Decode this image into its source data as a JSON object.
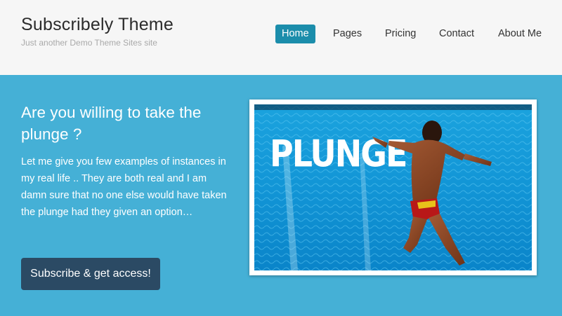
{
  "site": {
    "title": "Subscribely Theme",
    "tagline": "Just another Demo Theme Sites site"
  },
  "nav": {
    "items": [
      {
        "label": "Home",
        "active": true
      },
      {
        "label": "Pages",
        "active": false
      },
      {
        "label": "Pricing",
        "active": false
      },
      {
        "label": "Contact",
        "active": false
      },
      {
        "label": "About Me",
        "active": false
      }
    ]
  },
  "hero": {
    "heading": "Are you willing to take the plunge ?",
    "body": "Let me give you few examples of instances in my real life .. They are both real and I am damn sure that no one else would have taken the plunge had they given an option…",
    "cta_label": "Subscribe & get access!",
    "image_text": "PLUNGE"
  },
  "colors": {
    "accent": "#1b8dab",
    "hero_background": "#45b0d6",
    "button": "#2b4a64",
    "header_background": "#f6f6f6"
  }
}
